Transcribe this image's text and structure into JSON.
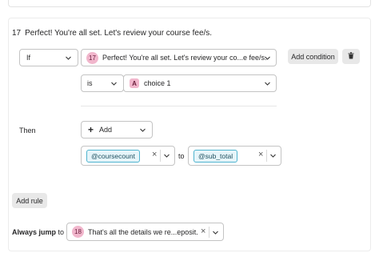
{
  "question": {
    "number": "17",
    "text": "Perfect! You're all set. Let's review your course fee/s."
  },
  "condition": {
    "operator_select": "If",
    "question_select": {
      "badge": "17",
      "text": "Perfect! You're all set. Let's review your co...e fee/s."
    },
    "compare_select": "is",
    "choice_select": {
      "badge": "A",
      "text": "choice 1"
    },
    "add_condition_label": "Add condition"
  },
  "then": {
    "label": "Then",
    "action_select": {
      "icon": "+",
      "text": "Add"
    },
    "left_variable": "@coursecount",
    "to_label": "to",
    "right_variable": "@sub_total"
  },
  "add_rule_label": "Add rule",
  "always_jump": {
    "label_bold": "Always jump",
    "label_rest": "to",
    "target": {
      "badge": "18",
      "text": "That's all the details we re...eposit."
    }
  },
  "colors": {
    "pill_bg": "#f1b6cc",
    "tag_border": "#4fb4cf",
    "tag_bg": "#e6f5fa",
    "gray_button": "#e8e8e8"
  }
}
